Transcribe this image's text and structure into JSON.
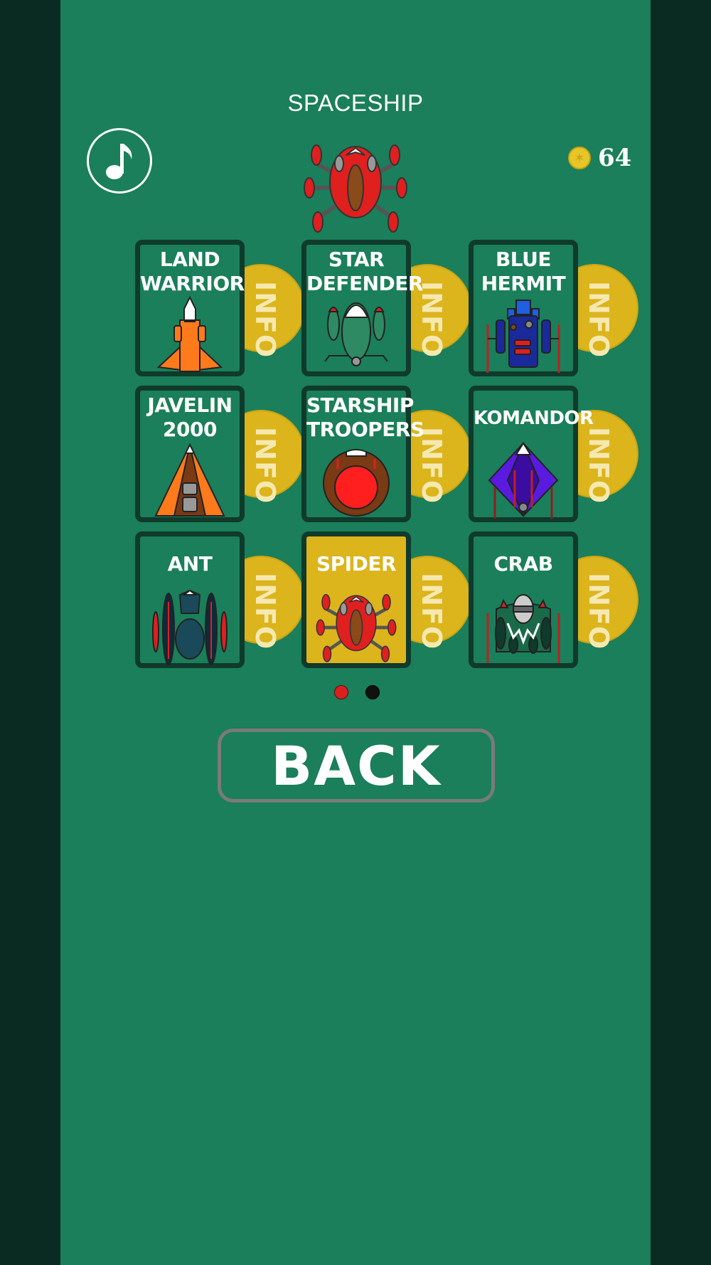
{
  "header": {
    "title": "SPACESHIP"
  },
  "coins": {
    "count": "64"
  },
  "info_label": "INFO",
  "ships": [
    {
      "name_line1": "LAND",
      "name_line2": "WARRIOR",
      "icon": "land-warrior-ship-icon",
      "selected": false
    },
    {
      "name_line1": "STAR",
      "name_line2": "DEFENDER",
      "icon": "star-defender-ship-icon",
      "selected": false
    },
    {
      "name_line1": "BLUE",
      "name_line2": "HERMIT",
      "icon": "blue-hermit-ship-icon",
      "selected": false
    },
    {
      "name_line1": "JAVELIN",
      "name_line2": "2000",
      "icon": "javelin-2000-ship-icon",
      "selected": false
    },
    {
      "name_line1": "STARSHIP",
      "name_line2": "TROOPERS",
      "icon": "starship-troopers-ship-icon",
      "selected": false
    },
    {
      "name_line1": "KOMANDOR",
      "name_line2": "",
      "icon": "komandor-ship-icon",
      "selected": false
    },
    {
      "name_line1": "ANT",
      "name_line2": "",
      "icon": "ant-ship-icon",
      "selected": false
    },
    {
      "name_line1": "SPIDER",
      "name_line2": "",
      "icon": "spider-ship-icon",
      "selected": true
    },
    {
      "name_line1": "CRAB",
      "name_line2": "",
      "icon": "crab-ship-icon",
      "selected": false
    }
  ],
  "pagination": {
    "pages": 2,
    "current": 1
  },
  "back_button": {
    "label": "BACK"
  },
  "colors": {
    "background": "#1a7f5a",
    "side_bars": "#0a2b22",
    "card_border": "#0f3a2c",
    "selected": "#dcb41c",
    "accent_red": "#e01f1f"
  }
}
